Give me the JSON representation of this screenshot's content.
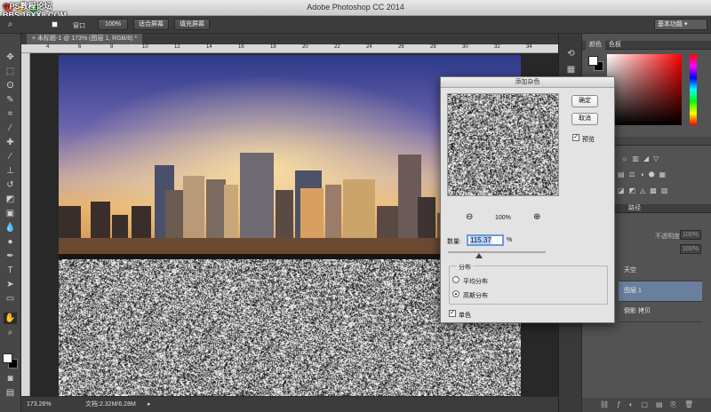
{
  "window": {
    "title": "Adobe Photoshop CC 2014",
    "watermark_line1": "PS教程论坛",
    "watermark_line2": "BBS.16XX8.COM"
  },
  "options_bar": {
    "window_checkbox_label": "窗口",
    "zoom_100_label": "100%",
    "fit_screen_label": "适合屏幕",
    "fill_screen_label": "填充屏幕",
    "workspace_label": "基本功能"
  },
  "document": {
    "tab_title": "未标题-1 @ 173% (图层 1, RGB/8) *",
    "ruler_ticks": [
      "4",
      "6",
      "8",
      "10",
      "12",
      "14",
      "16",
      "18",
      "20",
      "22",
      "24",
      "26",
      "28",
      "30",
      "32",
      "34"
    ]
  },
  "status": {
    "zoom": "173.26%",
    "doc_size": "文档:2.32M/6.28M"
  },
  "color_panel": {
    "tab_color": "颜色",
    "tab_swatches": "色板"
  },
  "layers_panel": {
    "tab_paths": "路径",
    "opacity_label": "不透明度:",
    "opacity_value": "100%",
    "fill_value": "100%",
    "layers": [
      {
        "name": "天空"
      },
      {
        "name": "图层 1",
        "selected": true
      },
      {
        "name": "倒影 拷贝"
      }
    ]
  },
  "dialog": {
    "title": "添加杂色",
    "ok_label": "确定",
    "cancel_label": "取消",
    "preview_label": "预览",
    "preview_checked": true,
    "zoom_level": "100%",
    "amount_label": "数量:",
    "amount_value": "115.37",
    "amount_unit": "%",
    "distribution_label": "分布",
    "uniform_label": "平均分布",
    "gaussian_label": "高斯分布",
    "selected_distribution": "gaussian",
    "monochromatic_label": "单色",
    "monochromatic_checked": true
  },
  "colors": {
    "foreground": "#ffffff",
    "background": "#000000",
    "selected_layer_bg": "#6a7f9e"
  }
}
